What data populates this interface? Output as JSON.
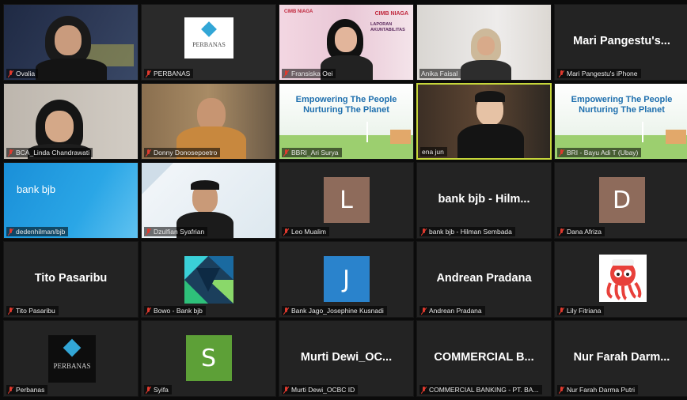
{
  "participants": [
    {
      "name": "Ovalia"
    },
    {
      "name": "PERBANAS",
      "logo_text": "PERBANAS"
    },
    {
      "name": "Fransiska Oei",
      "slide_brand": "CIMB NIAGA",
      "slide_title": "LAPORAN AKUNTABILITAS"
    },
    {
      "name": "Anika Faisal"
    },
    {
      "name": "Mari Pangestu's iPhone",
      "display": "Mari  Pangestu's..."
    },
    {
      "name": "BCA_Linda Chandrawati"
    },
    {
      "name": "Donny Donosepoetro"
    },
    {
      "name": "BBRI_Ari Surya",
      "slide_line1": "Empowering The People",
      "slide_line2": "Nurturing The Planet"
    },
    {
      "name": "ena jun"
    },
    {
      "name": "BRI - Bayu Adi T (Ubay)",
      "slide_line1": "Empowering The People",
      "slide_line2": "Nurturing The Planet"
    },
    {
      "name": "dedenhilman/bjb",
      "logo_text": "bank bjb"
    },
    {
      "name": "Dzulfian Syafrian"
    },
    {
      "name": "Leo Mualim",
      "initial": "L",
      "color": "#8e6b5b"
    },
    {
      "name": "bank bjb - Hilman Sembada",
      "display": "bank bjb - Hilm..."
    },
    {
      "name": "Dana Afriza",
      "initial": "D",
      "color": "#8e6b5b"
    },
    {
      "name": "Tito Pasaribu",
      "display": "Tito Pasaribu"
    },
    {
      "name": "Bowo - Bank bjb"
    },
    {
      "name": "Bank Jago_Josephine Kusnadi",
      "initial": "J",
      "color": "#2a83cc"
    },
    {
      "name": "Andrean Pradana",
      "display": "Andrean Pradana"
    },
    {
      "name": "Lily Fitriana"
    },
    {
      "name": "Perbanas",
      "logo_text": "PERBANAS"
    },
    {
      "name": "Syifa",
      "initial": "S",
      "color": "#5da037"
    },
    {
      "name": "Murti Dewi_OCBC ID",
      "display": "Murti  Dewi_OC..."
    },
    {
      "name": "COMMERCIAL BANKING - PT. BA...",
      "display": "COMMERCIAL  B..."
    },
    {
      "name": "Nur Farah Darma Putri",
      "display": "Nur Farah Darm..."
    }
  ],
  "colors": {
    "active_border": "#c6d63a",
    "muted_mic": "#e03a2e",
    "tile_bg": "#232323"
  }
}
